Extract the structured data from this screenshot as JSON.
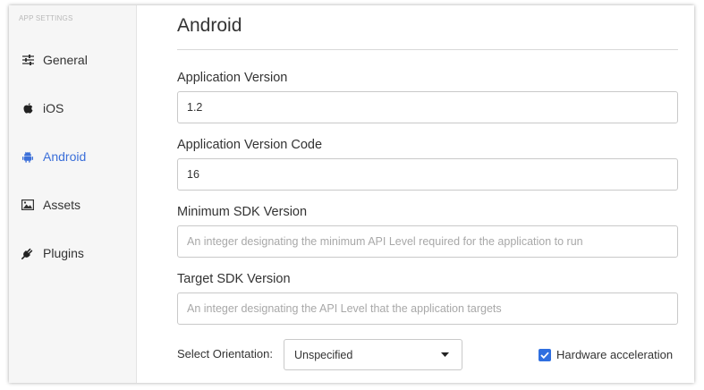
{
  "sidebar": {
    "header": "APP SETTINGS",
    "items": [
      {
        "label": "General",
        "icon": "sliders-icon"
      },
      {
        "label": "iOS",
        "icon": "apple-icon"
      },
      {
        "label": "Android",
        "icon": "android-icon",
        "active": true
      },
      {
        "label": "Assets",
        "icon": "image-icon"
      },
      {
        "label": "Plugins",
        "icon": "plug-icon"
      }
    ]
  },
  "main": {
    "title": "Android",
    "fields": {
      "app_version": {
        "label": "Application Version",
        "value": "1.2",
        "placeholder": ""
      },
      "app_version_code": {
        "label": "Application Version Code",
        "value": "16",
        "placeholder": ""
      },
      "min_sdk": {
        "label": "Minimum SDK Version",
        "value": "",
        "placeholder": "An integer designating the minimum API Level required for the application to run"
      },
      "target_sdk": {
        "label": "Target SDK Version",
        "value": "",
        "placeholder": "An integer designating the API Level that the application targets"
      }
    },
    "orientation": {
      "label": "Select Orientation:",
      "selected": "Unspecified"
    },
    "hardware_acceleration": {
      "label": "Hardware acceleration",
      "checked": true
    }
  },
  "colors": {
    "accent": "#3b6fd9",
    "checkbox": "#2f6fe0",
    "sidebar_bg": "#f6f6f6"
  }
}
